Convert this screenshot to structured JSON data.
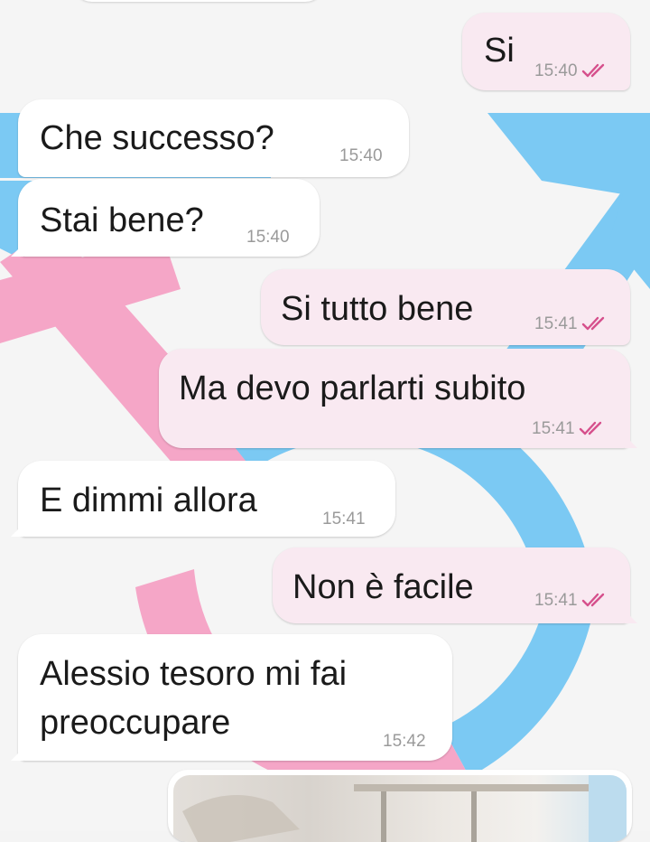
{
  "chat": {
    "messages": [
      {
        "text": "Si",
        "time": "15:40",
        "direction": "outgoing",
        "read": true
      },
      {
        "text": "Che successo?",
        "time": "15:40",
        "direction": "incoming"
      },
      {
        "text": "Stai bene?",
        "time": "15:40",
        "direction": "incoming"
      },
      {
        "text": "Si tutto bene",
        "time": "15:41",
        "direction": "outgoing",
        "read": true
      },
      {
        "text": "Ma devo parlarti subito",
        "time": "15:41",
        "direction": "outgoing",
        "read": true
      },
      {
        "text": "E dimmi allora",
        "time": "15:41",
        "direction": "incoming"
      },
      {
        "text": "Non è facile",
        "time": "15:41",
        "direction": "outgoing",
        "read": true
      },
      {
        "lines": [
          "Alessio tesoro mi fai",
          "preoccupare"
        ],
        "time": "15:42",
        "direction": "incoming"
      }
    ],
    "attachment": {
      "type": "photo"
    }
  },
  "colors": {
    "outgoing_bubble": "#f9e9f1",
    "incoming_bubble": "#ffffff",
    "read_ticks": "#d6508c",
    "wallpaper_blue": "#69c2f2",
    "wallpaper_pink": "#f49ac0"
  },
  "icons": {
    "read_receipt": "double-check-icon"
  }
}
